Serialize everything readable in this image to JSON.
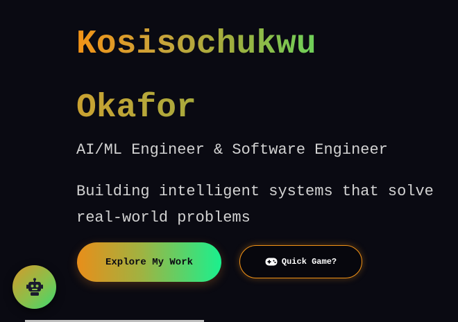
{
  "hero": {
    "name_line1": "Kosisochukwu",
    "name_line2": "Okafor",
    "role": "AI/ML Engineer & Software Engineer",
    "tagline": "Building intelligent systems that solve real-world problems"
  },
  "actions": {
    "primary_label": "Explore My Work",
    "secondary_label": "Quick Game?",
    "secondary_icon": "gamepad-icon"
  },
  "chatbot": {
    "icon": "robot-icon"
  },
  "colors": {
    "background": "#0a0a12",
    "accent_orange": "#f39316",
    "accent_green": "#1af08e",
    "text": "#d2d2d2"
  }
}
